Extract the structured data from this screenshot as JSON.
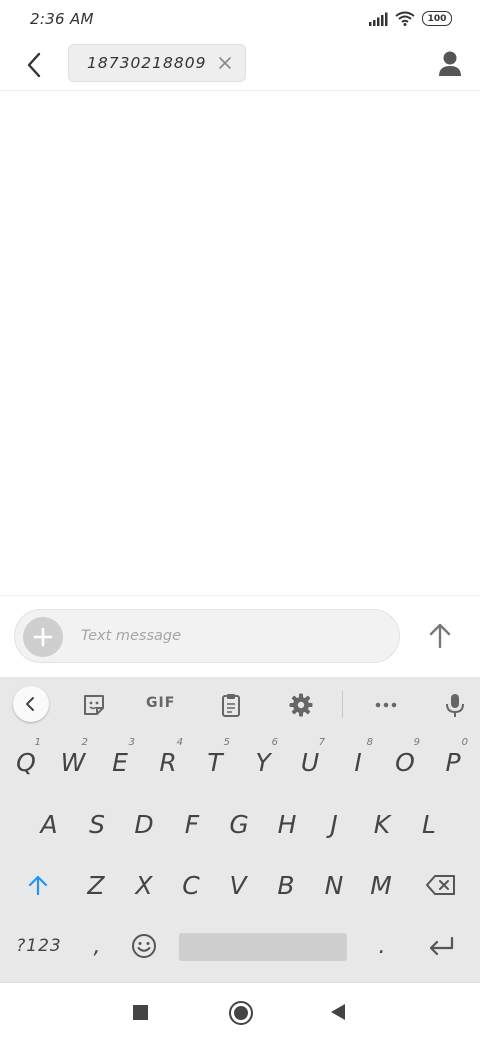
{
  "status_bar": {
    "time": "2:36 AM",
    "battery": "100",
    "icons": [
      "signal-icon",
      "wifi-icon",
      "battery-icon"
    ]
  },
  "app_bar": {
    "recipient": "18730218809",
    "icons": [
      "back-arrow-icon",
      "close-icon",
      "contact-icon"
    ]
  },
  "compose": {
    "placeholder": "Text message",
    "icons": [
      "add-icon",
      "send-arrow-icon"
    ]
  },
  "keyboard": {
    "toolbar": {
      "gif_label": "GIF",
      "icons": [
        "collapse-chevron-icon",
        "sticker-icon",
        "clipboard-icon",
        "settings-gear-icon",
        "more-dots-icon",
        "microphone-icon"
      ]
    },
    "row1": [
      {
        "label": "Q",
        "hint": "1"
      },
      {
        "label": "W",
        "hint": "2"
      },
      {
        "label": "E",
        "hint": "3"
      },
      {
        "label": "R",
        "hint": "4"
      },
      {
        "label": "T",
        "hint": "5"
      },
      {
        "label": "Y",
        "hint": "6"
      },
      {
        "label": "U",
        "hint": "7"
      },
      {
        "label": "I",
        "hint": "8"
      },
      {
        "label": "O",
        "hint": "9"
      },
      {
        "label": "P",
        "hint": "0"
      }
    ],
    "row2": [
      "A",
      "S",
      "D",
      "F",
      "G",
      "H",
      "J",
      "K",
      "L"
    ],
    "row3": [
      "Z",
      "X",
      "C",
      "V",
      "B",
      "N",
      "M"
    ],
    "row4": {
      "symbols_label": "?123",
      "comma": ",",
      "period": "."
    },
    "accent_color": "#2196f3"
  }
}
